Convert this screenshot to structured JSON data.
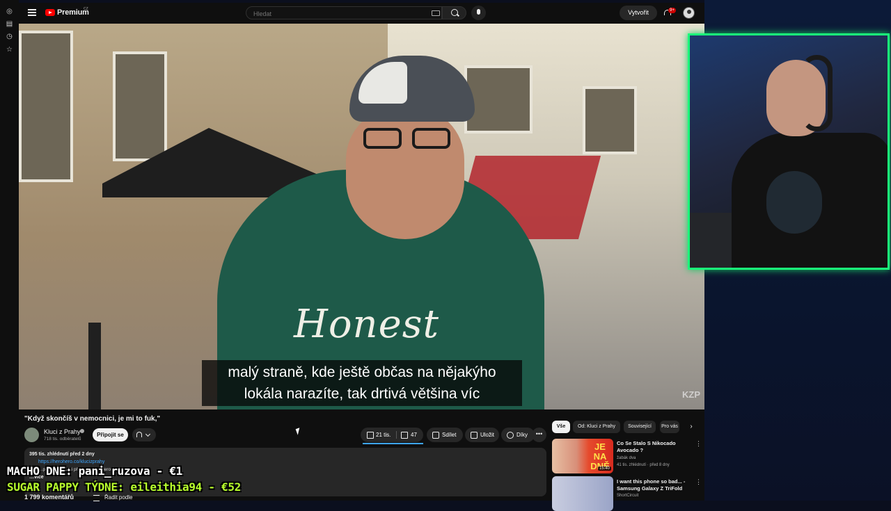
{
  "header": {
    "brand": "Premium",
    "country": "CZ",
    "search_placeholder": "Hledat",
    "create_label": "Vytvořit",
    "notifications_badge": "9+"
  },
  "video": {
    "subtitle_line1": "malý straně, kde ještě občas na nějakýho",
    "subtitle_line2": "lokála narazíte, tak drtivá většina víc",
    "hoodie_text": "Honest",
    "watermark": "KZP",
    "title": "\"Když skončíš v nemocnici, je mi to fuk,\""
  },
  "channel": {
    "name": "Kluci z Prahy",
    "subscribers": "718 tis. odběratelů",
    "join_label": "Připojit se"
  },
  "actions": {
    "likes": "21 tis.",
    "dislikes": "47",
    "share": "Sdílet",
    "save": "Uložit",
    "thanks": "Díky",
    "more": "•••"
  },
  "description": {
    "stats": "395 tis. zhlédnutí  před 2 dny",
    "link": "https://herohero.co/klucizprahy",
    "line": "…pro plnou verzi přejdi na náš HeroHero",
    "more": "…více"
  },
  "comments": {
    "count": "1 799 komentářů",
    "sort_label": "Řadit podle"
  },
  "sidebar_chips": [
    "Vše",
    "Od: Kluci z Prahy",
    "Související",
    "Pro vás"
  ],
  "recommended": [
    {
      "thumb_text": "JE NA DNĚ",
      "duration": "15:40",
      "title": "Co Se Stalo S Nikocado Avocado ?",
      "channel": "žabák dva",
      "meta": "41 tis. zhlédnutí · před 8 dny"
    },
    {
      "title": "I want this phone so bad... - Samsung Galaxy Z TriFold",
      "channel": "ShortCircuit"
    }
  ],
  "overlay": {
    "line1": "MACHO DNE: pani_ruzova - €1",
    "line2": "SUGAR PAPPY TÝDNE: eileithia94 - €52"
  },
  "colors": {
    "accent": "#3ea6ff",
    "youtube_red": "#ff0000",
    "webcam_border": "#1aff7a",
    "overlay_green": "#b8ff2c"
  }
}
